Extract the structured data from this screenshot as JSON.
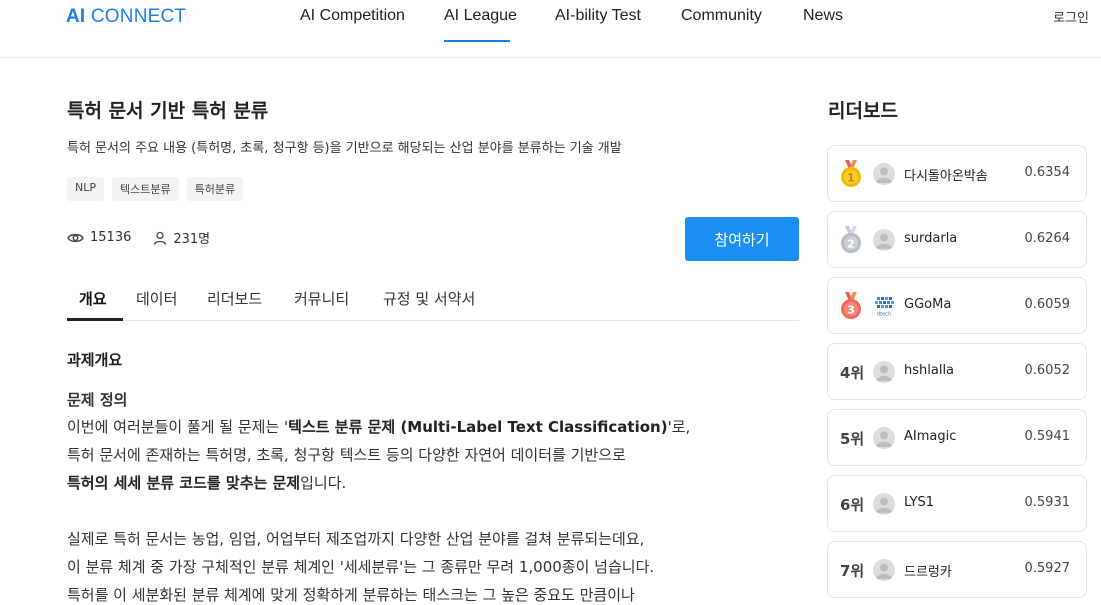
{
  "header": {
    "logo_ai": "AI",
    "logo_connect": "CONNECT",
    "nav": [
      "AI Competition",
      "AI League",
      "AI-bility Test",
      "Community",
      "News"
    ],
    "login": "로그인"
  },
  "competition": {
    "title": "특허 문서 기반 특허 분류",
    "description": "특허 문서의 주요 내용 (특허명, 초록, 청구항 등)을 기반으로 해당되는 산업 분야를 분류하는 기술 개발",
    "tags": [
      "NLP",
      "텍스트분류",
      "특허분류"
    ],
    "views": "15136",
    "participants": "231명",
    "join_label": "참여하기"
  },
  "tabs": [
    "개요",
    "데이터",
    "리더보드",
    "커뮤니티",
    "규정 및 서약서"
  ],
  "overview": {
    "section_title": "과제개요",
    "sub_title": "문제 정의",
    "line1_a": "이번에 여러분들이 풀게 될 문제는 '",
    "line1_b": "텍스트 분류 문제 (Multi-Label Text Classification)",
    "line1_c": "'로,",
    "line2": "특허 문서에 존재하는 특허명, 초록, 청구항 텍스트 등의 다양한 자연어 데이터를 기반으로",
    "line3_a": "특허의 세세 분류 코드를 맞추는 문제",
    "line3_b": "입니다.",
    "line4": "실제로 특허 문서는 농업, 임업, 어업부터 제조업까지 다양한 산업 분야를 걸쳐 분류되는데요,",
    "line5": "이 분류 체계 중 가장 구체적인 분류 체계인 '세세분류'는 그 종류만 무려 1,000종이 넘습니다.",
    "line6": "특허를 이 세분화된 분류 체계에 맞게 정확하게 분류하는 태스크는 그 높은 중요도 만큼이나"
  },
  "leaderboard": {
    "title": "리더보드",
    "entries": [
      {
        "rank": "1",
        "name": "다시돌아온박솜",
        "score": "0.6354"
      },
      {
        "rank": "2",
        "name": "surdarla",
        "score": "0.6264"
      },
      {
        "rank": "3",
        "name": "GGoMa",
        "score": "0.6059",
        "team_logo_text": "dtech"
      },
      {
        "rank": "4위",
        "name": "hshlalla",
        "score": "0.6052"
      },
      {
        "rank": "5위",
        "name": "AImagic",
        "score": "0.5941"
      },
      {
        "rank": "6위",
        "name": "LYS1",
        "score": "0.5931"
      },
      {
        "rank": "7위",
        "name": "드르렁카",
        "score": "0.5927"
      }
    ]
  },
  "colors": {
    "accent": "#1a8ff0",
    "gold": "#f2b705",
    "silver": "#b9c1c9",
    "bronze": "#ef6b57"
  }
}
